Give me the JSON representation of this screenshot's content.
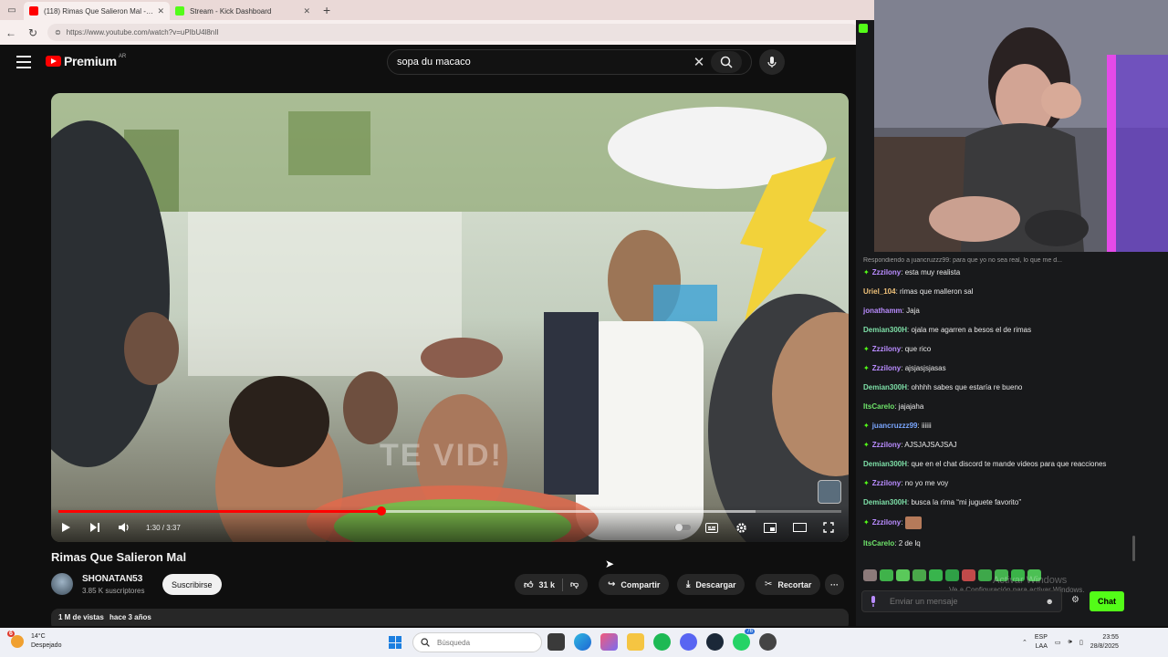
{
  "browser": {
    "tabs": [
      {
        "title": "(118) Rimas Que Salieron Mal - YouTube",
        "favicon_color": "#ff0000",
        "active": true
      },
      {
        "title": "Stream - Kick Dashboard",
        "favicon_color": "#53fc18",
        "active": false
      }
    ],
    "url": "https://www.youtube.com/watch?v=uPIbU4l8nII"
  },
  "youtube": {
    "logo_text": "Premium",
    "region": "AR",
    "search_value": "sopa du macaco",
    "player": {
      "time": "1:30 / 3:37",
      "progress_fraction": 0.413,
      "buffer_fraction": 0.89,
      "watermark": "TE VID!"
    },
    "video_title": "Rimas Que Salieron Mal",
    "channel_name": "SHONATAN53",
    "subscribers": "3.85 K suscriptores",
    "subscribe_label": "Suscribirse",
    "likes": "31 k",
    "share_label": "Compartir",
    "download_label": "Descargar",
    "clip_label": "Recortar",
    "more_label": "···",
    "views": "1 M de vistas",
    "age": "hace 3 años"
  },
  "kick_chat": {
    "reply_hint": "Respondiendo a juancruzzz99: para que yo no sea real, lo que me d...",
    "messages": [
      {
        "user": "Zzzilony",
        "color": "#b98cff",
        "badge": true,
        "text": "esta muy realista"
      },
      {
        "user": "Uriel_104",
        "color": "#f0c27a",
        "badge": false,
        "text": "rimas que malleron sal"
      },
      {
        "user": "jonathamm",
        "color": "#b98cff",
        "badge": false,
        "text": "Jaja"
      },
      {
        "user": "Demian300H",
        "color": "#7ee0a8",
        "badge": false,
        "text": "ojala me agarren a besos el de rimas"
      },
      {
        "user": "Zzzilony",
        "color": "#b98cff",
        "badge": true,
        "text": "que rico"
      },
      {
        "user": "Zzzilony",
        "color": "#b98cff",
        "badge": true,
        "text": "ajsjasjsjasas"
      },
      {
        "user": "Demian300H",
        "color": "#7ee0a8",
        "badge": false,
        "text": "ohhhh sabes que estaría re bueno"
      },
      {
        "user": "ItsCarelo",
        "color": "#6ee36a",
        "badge": false,
        "text": "jajajaha"
      },
      {
        "user": "juancruzzz99",
        "color": "#7aa6ff",
        "badge": true,
        "text": "iiiiii"
      },
      {
        "user": "Zzzilony",
        "color": "#b98cff",
        "badge": true,
        "text": "AJSJAJSAJSAJ"
      },
      {
        "user": "Demian300H",
        "color": "#7ee0a8",
        "badge": false,
        "text": "que en el chat discord te mande videos para que reacciones"
      },
      {
        "user": "Zzzilony",
        "color": "#b98cff",
        "badge": true,
        "text": "no yo me voy"
      },
      {
        "user": "Demian300H",
        "color": "#7ee0a8",
        "badge": false,
        "text": "busca la rima “mi juguete favorito”"
      },
      {
        "user": "Zzzilony",
        "color": "#b98cff",
        "badge": true,
        "text": "",
        "emote": true
      },
      {
        "user": "ItsCarelo",
        "color": "#6ee36a",
        "badge": false,
        "text": "2 de lq"
      }
    ],
    "input_placeholder": "Enviar un mensaje",
    "chat_button": "Chat",
    "windows_activation": "Ve a Configuración para activar Windows.",
    "windows_activation_title": "Activar Windows"
  },
  "taskbar": {
    "weather_temp": "14°C",
    "weather_desc": "Despejado",
    "weather_badge": "6",
    "search_placeholder": "Búsqueda",
    "whatsapp_count": "76",
    "lang_top": "ESP",
    "lang_bottom": "LAA",
    "time": "23:55",
    "date": "28/8/2025"
  },
  "colors": {
    "youtube_red": "#ff0000",
    "kick_green": "#53fc18"
  }
}
